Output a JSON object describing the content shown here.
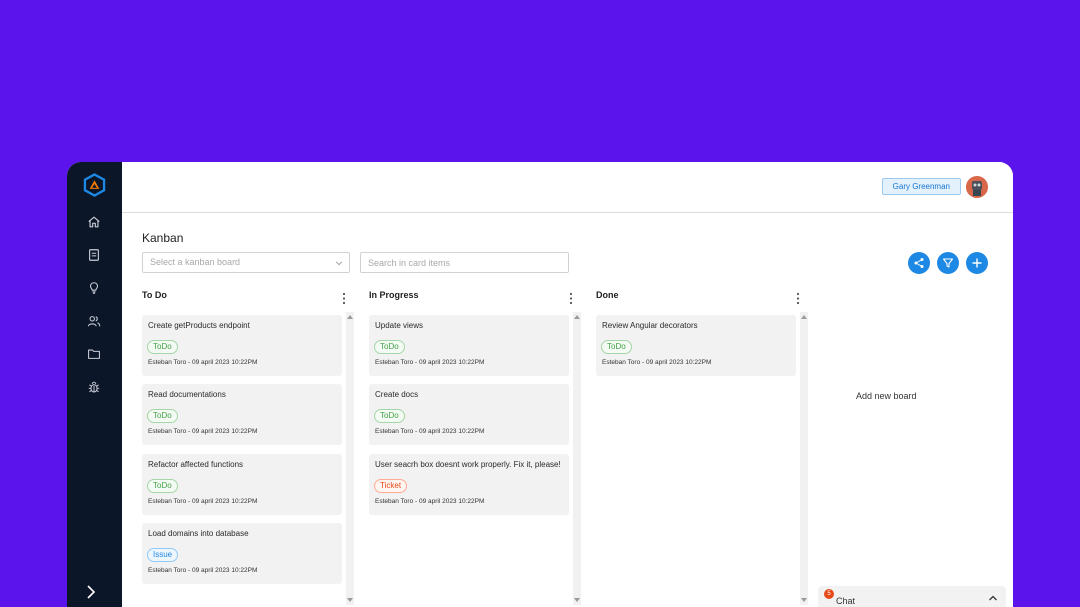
{
  "app": {
    "page_title": "Kanban",
    "user_name": "Gary Greenman"
  },
  "toolbar": {
    "board_select_placeholder": "Select a kanban board",
    "search_placeholder": "Search in card items"
  },
  "columns": [
    {
      "title": "To Do",
      "cards": [
        {
          "title": "Create  getProducts endpoint",
          "tag": "ToDo",
          "meta": "Esteban Toro - 09 april 2023 10:22PM"
        },
        {
          "title": "Read documentations",
          "tag": "ToDo",
          "meta": "Esteban Toro - 09 april 2023 10:22PM"
        },
        {
          "title": "Refactor affected functions",
          "tag": "ToDo",
          "meta": "Esteban Toro - 09 april 2023 10:22PM"
        },
        {
          "title": "Load domains into database",
          "tag": "Issue",
          "meta": "Esteban Toro - 09 april 2023 10:22PM"
        }
      ]
    },
    {
      "title": "In Progress",
      "cards": [
        {
          "title": "Update views",
          "tag": "ToDo",
          "meta": "Esteban Toro - 09 april 2023 10:22PM"
        },
        {
          "title": "Create docs",
          "tag": "ToDo",
          "meta": "Esteban Toro - 09 april 2023 10:22PM"
        },
        {
          "title": "User seacrh box doesnt work properly. Fix it, please!",
          "tag": "Ticket",
          "meta": "Esteban Toro - 09 april 2023 10:22PM"
        }
      ]
    },
    {
      "title": "Done",
      "cards": [
        {
          "title": "Review Angular decorators",
          "tag": "ToDo",
          "meta": "Esteban Toro - 09 april 2023 10:22PM"
        }
      ]
    }
  ],
  "add_board_label": "Add new board",
  "chat": {
    "label": "Chat",
    "badge_count": "5"
  },
  "colors": {
    "background": "#5b14ec",
    "sidebar": "#0b1628",
    "accent": "#1e88e5",
    "tag_todo": "#43a047",
    "tag_issue": "#1e88e5",
    "tag_ticket": "#e64a19"
  },
  "icons": {
    "sidebar": [
      "home-icon",
      "book-icon",
      "lightbulb-icon",
      "users-icon",
      "folder-icon",
      "bug-icon"
    ],
    "actions": [
      "share-icon",
      "filter-icon",
      "plus-icon"
    ]
  }
}
